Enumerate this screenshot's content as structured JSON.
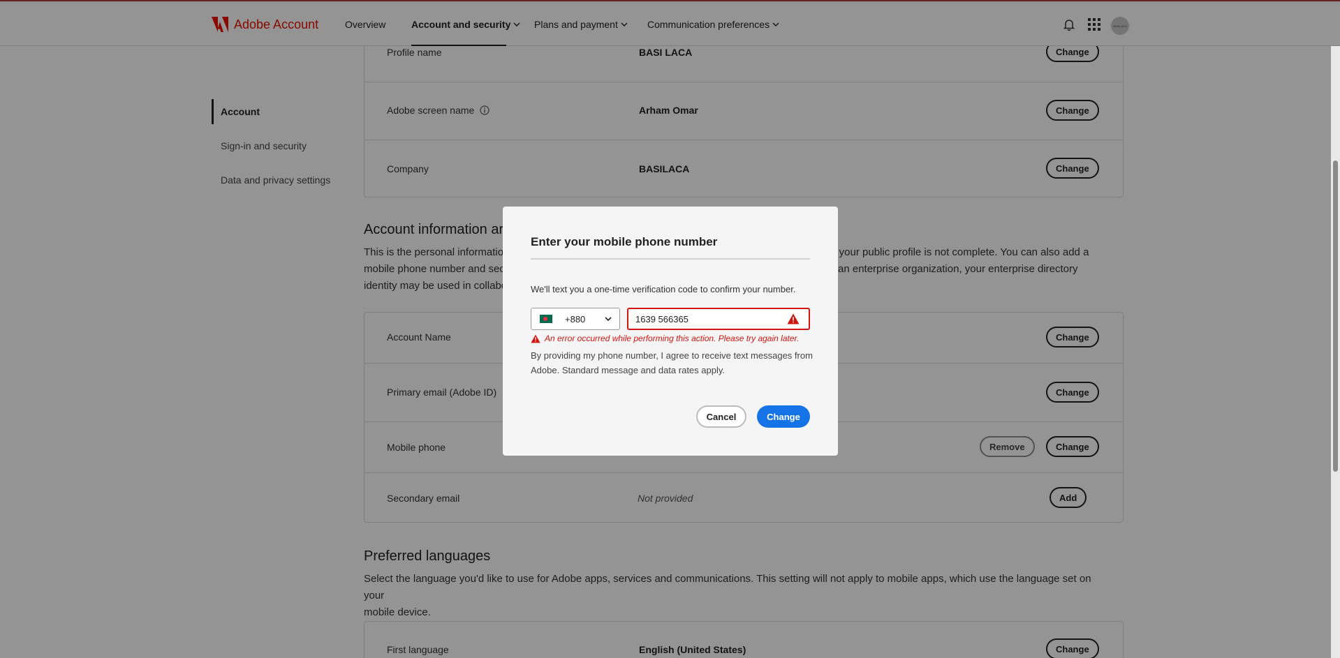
{
  "header": {
    "logo_text": "Adobe Account",
    "nav": [
      {
        "label": "Overview"
      },
      {
        "label": "Account and security"
      },
      {
        "label": "Plans and payment"
      },
      {
        "label": "Communication preferences"
      }
    ],
    "avatar_text": "BASILACA"
  },
  "sidebar": {
    "items": [
      {
        "label": "Account"
      },
      {
        "label": "Sign-in and security"
      },
      {
        "label": "Data and privacy settings"
      }
    ]
  },
  "profile": {
    "rows": [
      {
        "label": "Profile name",
        "value": "BASI LACA",
        "action": "Change"
      },
      {
        "label": "Adobe screen name",
        "value": "Arham Omar",
        "action": "Change"
      },
      {
        "label": "Company",
        "value": "BASILACA",
        "action": "Change"
      }
    ]
  },
  "account_info": {
    "title": "Account information ar",
    "description_lines": [
      "This is the personal informatio",
      "mobile phone number and sec",
      "identity may be used in collabo"
    ],
    "description_right_lines": [
      "ns if your public profile is not complete. You can also add a",
      "rt of an enterprise organization, your enterprise directory"
    ],
    "rows": [
      {
        "label": "Account Name",
        "action": "Change"
      },
      {
        "label": "Primary email (Adobe ID)",
        "action": "Change"
      },
      {
        "label": "Mobile phone",
        "secondary_action": "Remove",
        "action": "Change"
      },
      {
        "label": "Secondary email",
        "value": "Not provided",
        "action": "Add"
      }
    ]
  },
  "languages": {
    "title": "Preferred languages",
    "description_lines": [
      "Select the language you'd like to use for Adobe apps, services and communications. This setting will not apply to mobile apps, which use the language set on your",
      "mobile device."
    ],
    "rows": [
      {
        "label": "First language",
        "value": "English (United States)",
        "action": "Change"
      }
    ]
  },
  "modal": {
    "title": "Enter your mobile phone number",
    "description": "We'll text you a one-time verification code to confirm your number.",
    "country_code": "+880",
    "phone_value": "1639 566365",
    "error": "An error occurred while performing this action. Please try again later.",
    "consent": "By providing my phone number, I agree to receive text messages from Adobe. Standard message and data rates apply.",
    "cancel_label": "Cancel",
    "submit_label": "Change"
  },
  "colors": {
    "brand_red": "#eb1000",
    "primary_blue": "#1473e6",
    "error_red": "#d31510"
  },
  "icons": [
    "adobe-logo-icon",
    "chevron-down-icon",
    "bell-icon",
    "app-grid-icon",
    "info-icon",
    "warning-icon",
    "bangladesh-flag-icon"
  ]
}
